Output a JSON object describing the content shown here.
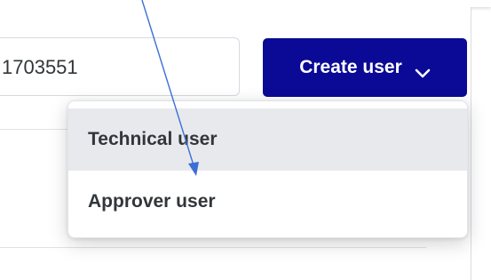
{
  "search": {
    "value": "1703551"
  },
  "toolbar": {
    "create_user_label": "Create user",
    "create_user_icon": "chevron-down-icon",
    "accent_color": "#0a0a96"
  },
  "menu": {
    "items": [
      {
        "label": "Technical user",
        "state": "hovered"
      },
      {
        "label": "Approver user",
        "state": "default"
      }
    ]
  },
  "annotation": {
    "arrow_color": "#3b6fd6",
    "arrow_icon": "arrow-annotation-icon"
  }
}
